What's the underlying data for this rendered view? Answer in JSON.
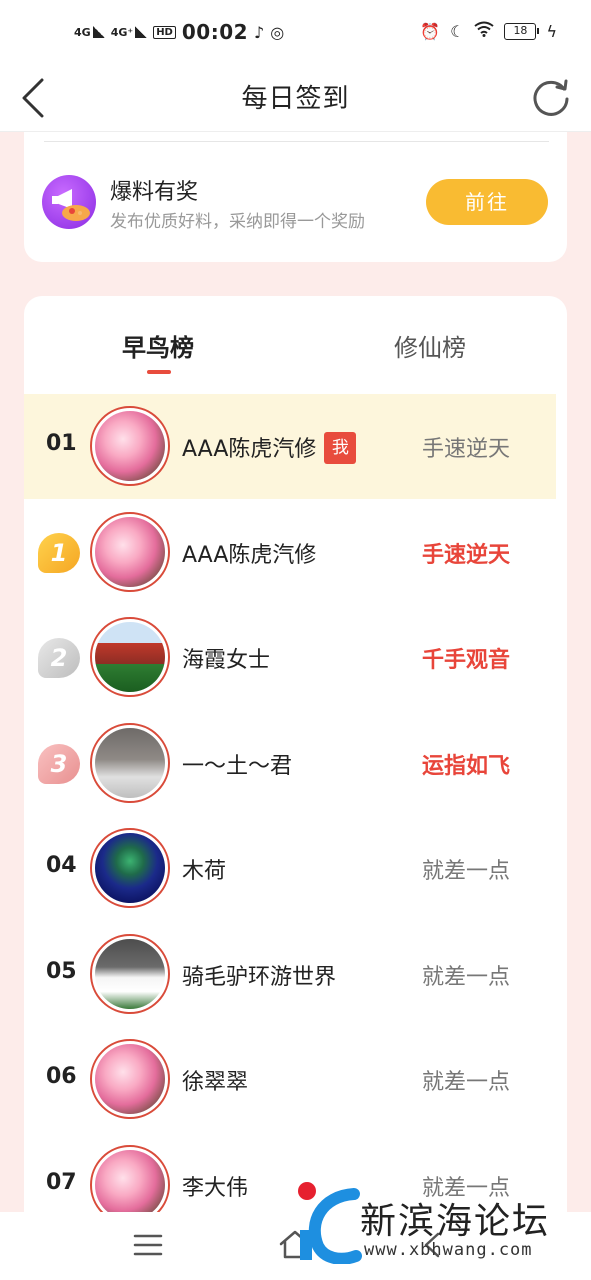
{
  "status_bar": {
    "network1": "4G",
    "network2": "4G⁺",
    "hd": "HD",
    "time": "00:02",
    "battery": "18"
  },
  "nav": {
    "title": "每日签到"
  },
  "promo": {
    "title": "爆料有奖",
    "subtitle": "发布优质好料，采纳即得一个奖励",
    "button": "前往"
  },
  "tabs": {
    "early": "早鸟榜",
    "xiuxian": "修仙榜"
  },
  "my_rank": {
    "rank": "01",
    "name": "AAA陈虎汽修",
    "badge": "我",
    "title": "手速逆天"
  },
  "ranking": [
    {
      "rank": "1",
      "name": "AAA陈虎汽修",
      "title": "手速逆天"
    },
    {
      "rank": "2",
      "name": "海霞女士",
      "title": "千手观音"
    },
    {
      "rank": "3",
      "name": "一～土～君",
      "title": "运指如飞"
    },
    {
      "rank": "04",
      "name": "木荷",
      "title": "就差一点"
    },
    {
      "rank": "05",
      "name": "骑毛驴环游世界",
      "title": "就差一点"
    },
    {
      "rank": "06",
      "name": "徐翠翠",
      "title": "就差一点"
    },
    {
      "rank": "07",
      "name": "李大伟",
      "title": "就差一点"
    }
  ],
  "watermark": {
    "title": "新滨海论坛",
    "url": "www.xbhwang.com"
  },
  "colors": {
    "accent_red": "#e8453a",
    "button_yellow": "#f9bb32",
    "highlight_row": "#fdf6dc",
    "page_bg": "#fdecea"
  }
}
